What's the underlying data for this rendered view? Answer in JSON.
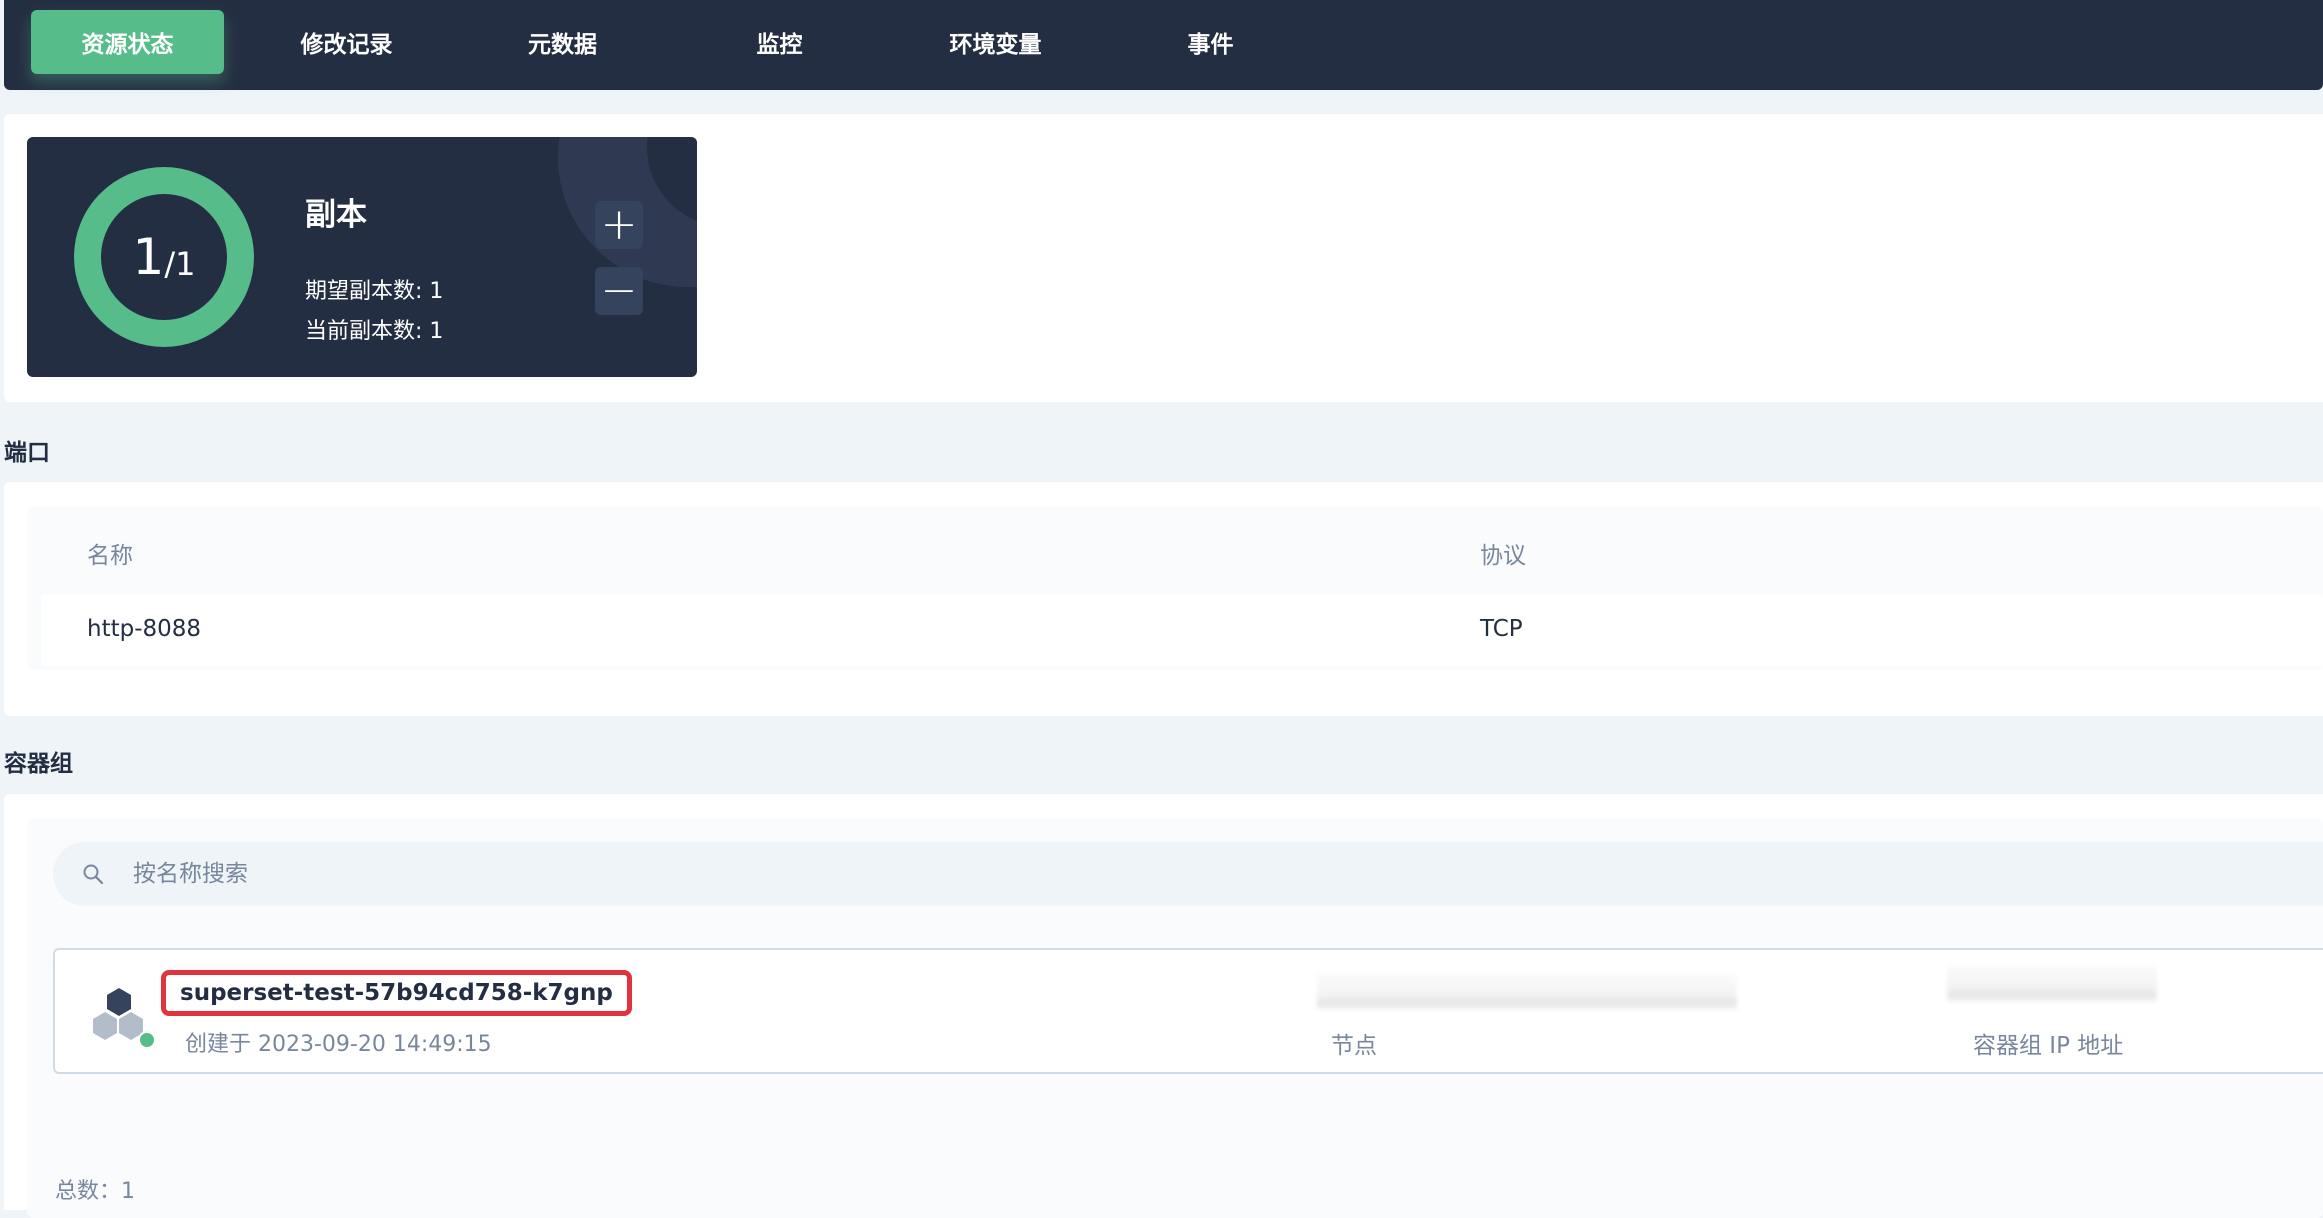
{
  "tabs": [
    {
      "label": "资源状态",
      "active": true
    },
    {
      "label": "修改记录",
      "active": false
    },
    {
      "label": "元数据",
      "active": false
    },
    {
      "label": "监控",
      "active": false
    },
    {
      "label": "环境变量",
      "active": false
    },
    {
      "label": "事件",
      "active": false
    }
  ],
  "replicas": {
    "current": "1",
    "desired": "1",
    "title": "副本",
    "desired_line": "期望副本数: 1",
    "current_line": "当前副本数: 1",
    "increase_symbol": "+",
    "decrease_symbol": "−"
  },
  "ports": {
    "section_title": "端口",
    "columns": [
      "名称",
      "协议"
    ],
    "rows": [
      {
        "name": "http-8088",
        "protocol": "TCP"
      }
    ]
  },
  "pods": {
    "section_title": "容器组",
    "search_placeholder": "按名称搜索",
    "items": [
      {
        "name": "superset-test-57b94cd758-k7gnp",
        "created": "创建于 2023-09-20 14:49:15",
        "node_label": "节点",
        "ip_label": "容器组 IP 地址",
        "status": "running"
      }
    ],
    "total": "总数：1"
  },
  "colors": {
    "primary_dark": "#242e42",
    "accent_green": "#55bc8a",
    "highlight_red": "#e0333a",
    "muted_text": "#79879c",
    "page_bg": "#eff4f9"
  }
}
